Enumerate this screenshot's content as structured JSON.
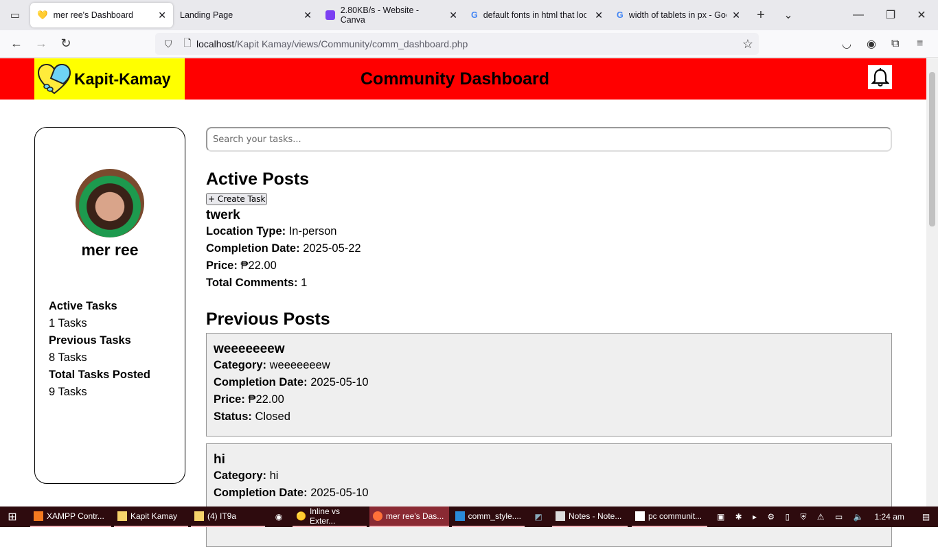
{
  "browser": {
    "tabs": [
      {
        "label": "mer ree's Dashboard",
        "active": true
      },
      {
        "label": "Landing Page"
      },
      {
        "label": "2.80KB/s - Website - Canva"
      },
      {
        "label": "default fonts in html that look"
      },
      {
        "label": "width of tablets in px - Googl"
      }
    ],
    "url_host": "localhost",
    "url_path": "/Kapit Kamay/views/Community/comm_dashboard.php"
  },
  "header": {
    "brand": "Kapit-Kamay",
    "title": "Community Dashboard",
    "colors": {
      "bar": "#ff0000",
      "logo_bg": "#ffff00"
    }
  },
  "profile": {
    "name": "mer ree",
    "stats": [
      {
        "label": "Active Tasks",
        "value": "1 Tasks"
      },
      {
        "label": "Previous Tasks",
        "value": "8 Tasks"
      },
      {
        "label": "Total Tasks Posted",
        "value": "9 Tasks"
      }
    ]
  },
  "main": {
    "search_placeholder": "Search your tasks...",
    "active_heading": "Active Posts",
    "create_label": "+ Create Task",
    "active_post": {
      "title": "twerk",
      "fields": [
        {
          "label": "Location Type:",
          "value": "In-person"
        },
        {
          "label": "Completion Date:",
          "value": "2025-05-22"
        },
        {
          "label": "Price:",
          "value": "₱22.00"
        },
        {
          "label": "Total Comments:",
          "value": "1"
        }
      ]
    },
    "previous_heading": "Previous Posts",
    "previous_posts": [
      {
        "title": "weeeeeeew",
        "fields": [
          {
            "label": "Category:",
            "value": "weeeeeeew"
          },
          {
            "label": "Completion Date:",
            "value": "2025-05-10"
          },
          {
            "label": "Price:",
            "value": "₱22.00"
          },
          {
            "label": "Status:",
            "value": "Closed"
          }
        ]
      },
      {
        "title": "hi",
        "fields": [
          {
            "label": "Category:",
            "value": "hi"
          },
          {
            "label": "Completion Date:",
            "value": "2025-05-10"
          }
        ]
      }
    ]
  },
  "taskbar": {
    "items": [
      "XAMPP Contr...",
      "Kapit Kamay",
      "(4) IT9a",
      "Inline vs Exter...",
      "mer ree's Das...",
      "comm_style....",
      "Notes - Note...",
      "pc communit..."
    ],
    "time": "1:24 am"
  }
}
